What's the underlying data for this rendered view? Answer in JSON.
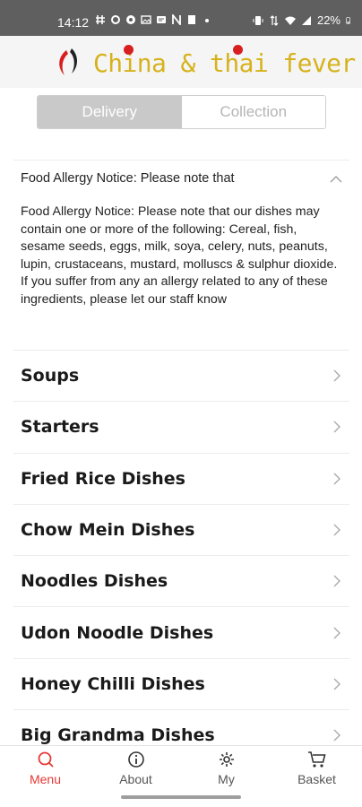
{
  "status_bar": {
    "time": "14:12",
    "battery": "22%",
    "left_icons": [
      "hash-icon",
      "settings-cog-icon",
      "chrome-icon",
      "image-icon",
      "app-icon",
      "n-icon",
      "file-icon",
      "dot-icon"
    ],
    "right_icons": [
      "vibrate-icon",
      "data-icon",
      "wifi-icon",
      "signal-icon",
      "battery-icon"
    ]
  },
  "header": {
    "logo_text": "China & thai fever",
    "logo_color": "#d6b21c",
    "accent_color": "#d81f1f"
  },
  "toggle": {
    "delivery_label": "Delivery",
    "collection_label": "Collection",
    "selected": "Delivery"
  },
  "allergy": {
    "title": "Food Allergy Notice: Please note that",
    "body": "Food Allergy Notice: Please note that our dishes may contain one or more of the following: Cereal, fish, sesame seeds, eggs, milk, soya, celery, nuts, peanuts, lupin, crustaceans, mustard, molluscs & sulphur dioxide. If you suffer from any an allergy related to any of these ingredients, please let our staff know",
    "expanded": true
  },
  "menu": {
    "items": [
      {
        "label": "Soups"
      },
      {
        "label": "Starters"
      },
      {
        "label": "Fried Rice Dishes"
      },
      {
        "label": "Chow Mein Dishes"
      },
      {
        "label": "Noodles Dishes"
      },
      {
        "label": "Udon Noodle Dishes"
      },
      {
        "label": "Honey Chilli Dishes"
      },
      {
        "label": "Big Grandma Dishes"
      }
    ]
  },
  "bottom_nav": {
    "items": [
      {
        "label": "Menu",
        "icon": "search-icon",
        "active": true
      },
      {
        "label": "About",
        "icon": "info-icon",
        "active": false
      },
      {
        "label": "My",
        "icon": "gear-icon",
        "active": false
      },
      {
        "label": "Basket",
        "icon": "cart-icon",
        "active": false
      }
    ],
    "active_color": "#e53935"
  }
}
